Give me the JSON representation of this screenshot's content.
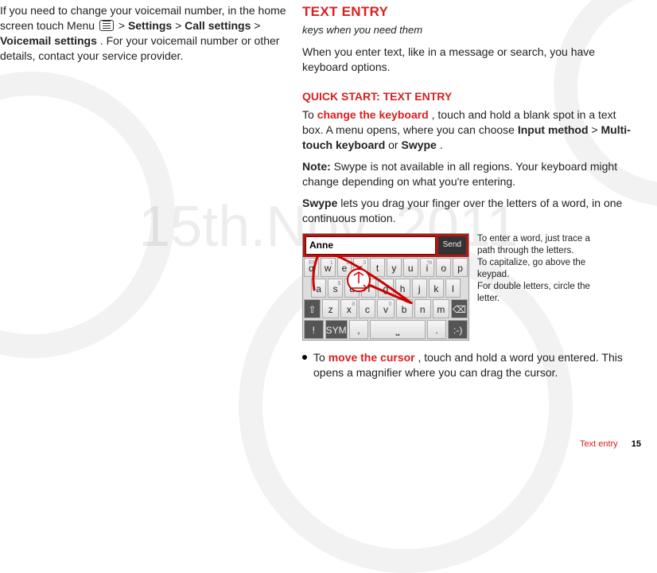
{
  "watermark": "15th.Nov, 2011",
  "left": {
    "p1a": "If you need to change your voicemail number, in the home screen touch Menu ",
    "p1b": " > ",
    "settings": "Settings",
    "p1c": " > ",
    "callSettings": "Call settings",
    "p1d": " > ",
    "vmSettings": "Voicemail settings",
    "p1e": ". For your voicemail number or other details, contact your service provider."
  },
  "right": {
    "h2": "TEXT ENTRY",
    "sub": "keys when you need them",
    "p1": "When you enter text, like in a message or search, you have keyboard options.",
    "h3": "QUICK START: TEXT ENTRY",
    "p2a": "To ",
    "change": "change the keyboard",
    "p2b": ", touch and hold a blank spot in a text box. A menu opens, where you can choose ",
    "inputMethod": "Input method",
    "p2c": " > ",
    "multi": "Multi-touch keyboard",
    "or": " or ",
    "swype": "Swype",
    "dot": ".",
    "noteLabel": "Note:",
    "noteBody": " Swype is not available in all regions. Your keyboard might change depending on what you're entering.",
    "p3a": "Swype",
    "p3b": " lets you drag your finger over the letters of a word, in one continuous motion.",
    "caption1": "To enter a word, just trace a path through the letters.",
    "caption2": "To capitalize, go above the keypad.",
    "caption3": "For double letters, circle the letter.",
    "bulletA": "To ",
    "moveCursor": "move the cursor",
    "bulletB": ", touch and hold a word you entered. This opens a magnifier where you can drag the cursor."
  },
  "kb": {
    "input": "Anne",
    "send": "Send",
    "row1": [
      "q",
      "w",
      "e",
      "r",
      "t",
      "y",
      "u",
      "i",
      "o",
      "p"
    ],
    "row1sup": [
      "EN",
      "1",
      "2",
      "3",
      "",
      "",
      "",
      "%",
      "",
      ""
    ],
    "row2": [
      "a",
      "s",
      "d",
      "f",
      "g",
      "h",
      "j",
      "k",
      "l"
    ],
    "row2sup": [
      "",
      "$",
      "",
      "",
      "",
      "",
      "",
      "",
      ""
    ],
    "row3shift": "⇧",
    "row3": [
      "z",
      "x",
      "c",
      "v",
      "b",
      "n",
      "m"
    ],
    "row3sup": [
      "",
      "8",
      "",
      "0",
      "",
      "",
      ""
    ],
    "row3del": "⌫",
    "row4": {
      "alert": "!",
      "sym": "SYM",
      "comma": ",",
      "space": "⎵",
      "period": ".",
      "smile": ":-)"
    }
  },
  "footer": {
    "label": "Text entry",
    "page": "15"
  }
}
